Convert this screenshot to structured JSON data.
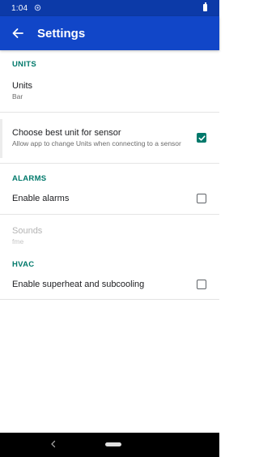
{
  "status_bar": {
    "time": "1:04",
    "notification_icon": "sensor-notification-icon",
    "battery_icon": "battery-icon"
  },
  "app_bar": {
    "back_icon": "arrow-back-icon",
    "title": "Settings",
    "color": "#1146c8"
  },
  "sections": {
    "units": {
      "header": "UNITS",
      "units_pref": {
        "title": "Units",
        "summary": "Bar"
      },
      "best_unit_pref": {
        "title": "Choose best unit for sensor",
        "summary": "Allow app to change Units when connecting to a sensor",
        "checked": true
      }
    },
    "alarms": {
      "header": "ALARMS",
      "enable_alarms_pref": {
        "title": "Enable alarms",
        "checked": false
      },
      "sounds_pref": {
        "title": "Sounds",
        "summary": "fme",
        "enabled": false
      }
    },
    "hvac": {
      "header": "HVAC",
      "superheat_pref": {
        "title": "Enable superheat and subcooling",
        "checked": false
      }
    }
  },
  "colors": {
    "accent": "#00796b",
    "status_bar": "#0c3aa8"
  },
  "nav_bar": {
    "back_icon": "nav-back-icon",
    "home_icon": "nav-home-pill-icon"
  }
}
